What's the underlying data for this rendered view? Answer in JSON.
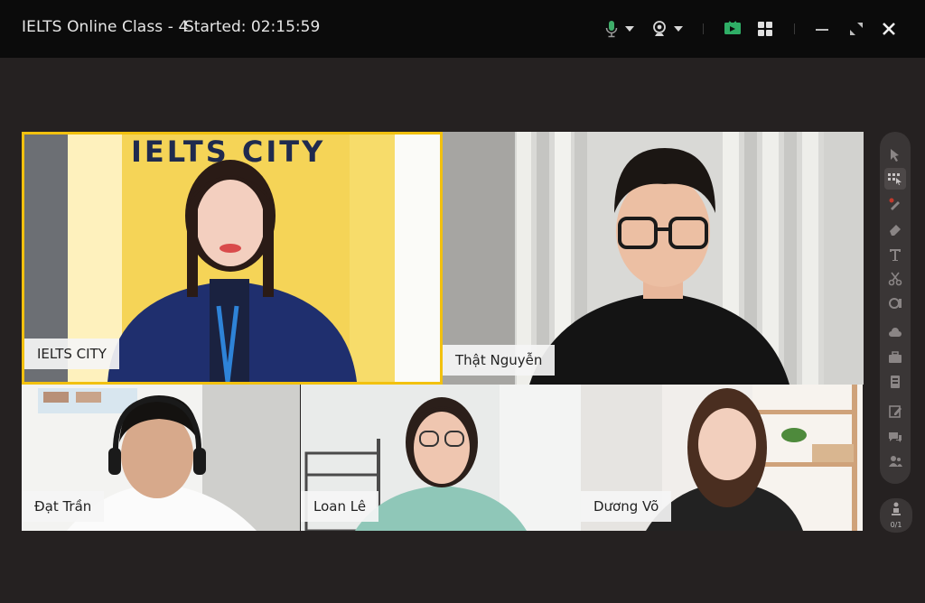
{
  "window": {
    "title": "IELTS Online Class - 4",
    "started": "Started: 02:15:59"
  },
  "colors": {
    "active_speaker_border": "#f2c10f",
    "mic_icon": "#3fae6a",
    "screen_share_icon": "#2fae66",
    "titlebar_bg": "#0b0b0b",
    "app_bg": "#252121"
  },
  "participants": [
    {
      "name": "IELTS CITY",
      "active": true
    },
    {
      "name": "Thật Nguyễn",
      "active": false
    },
    {
      "name": "Đạt Trần",
      "active": false
    },
    {
      "name": "Loan Lê",
      "active": false
    },
    {
      "name": "Dương Võ",
      "active": false
    }
  ],
  "banner": {
    "logo_text": "IELTS CITY"
  },
  "toolbar_icons": [
    "pointer-icon",
    "select-icon",
    "laser-pen-icon",
    "eraser-icon",
    "text-icon",
    "scissors-icon",
    "shape-icon",
    "cloud-icon",
    "briefcase-icon",
    "document-icon",
    "note-icon",
    "chat-icon",
    "members-icon"
  ],
  "raise_hand": {
    "count": "0/1"
  }
}
